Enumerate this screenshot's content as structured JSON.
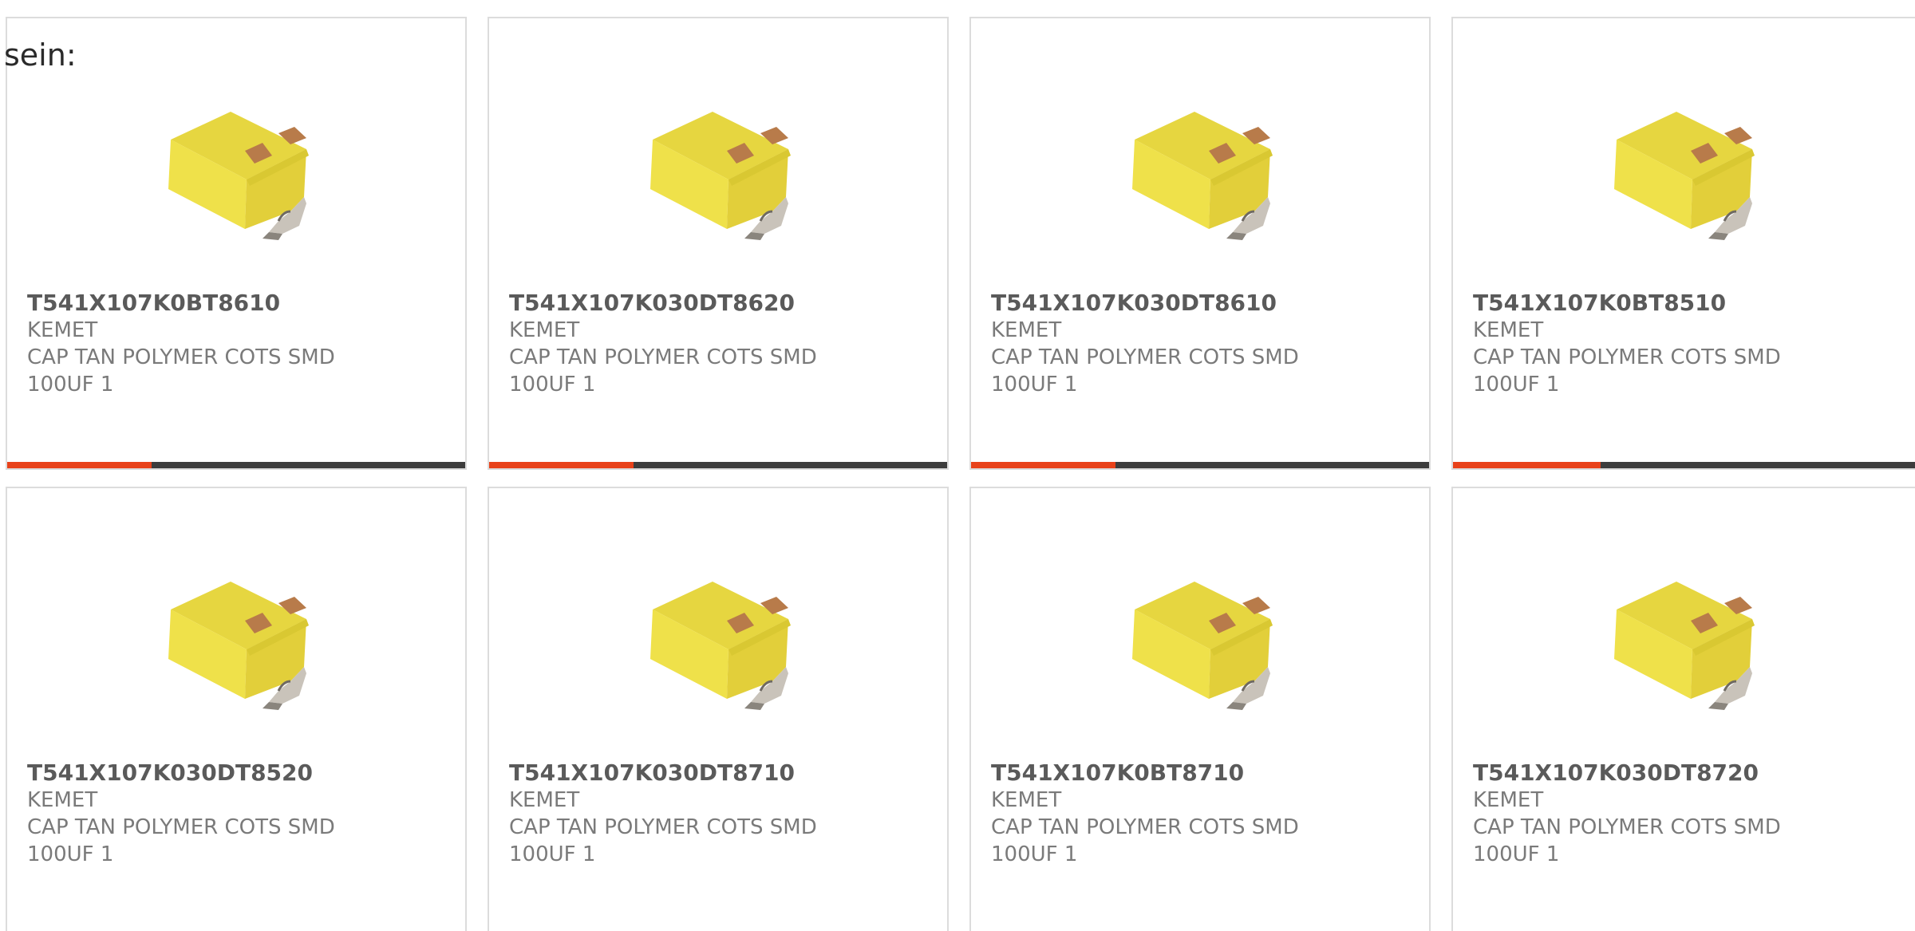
{
  "lead_text": "sein:",
  "colors": {
    "accent": "#e8421a",
    "bar": "#3d3d3d",
    "cap_body": "#efe14a",
    "terminal": "#b87b4a"
  },
  "progress_fraction": 0.315,
  "products": [
    {
      "part": "T541X107K0BT8610",
      "brand": "KEMET",
      "desc1": "CAP TAN POLYMER COTS SMD",
      "desc2": "100UF 1",
      "image": "tantalum-capacitor-icon"
    },
    {
      "part": "T541X107K030DT8620",
      "brand": "KEMET",
      "desc1": "CAP TAN POLYMER COTS SMD",
      "desc2": "100UF 1",
      "image": "tantalum-capacitor-icon"
    },
    {
      "part": "T541X107K030DT8610",
      "brand": "KEMET",
      "desc1": "CAP TAN POLYMER COTS SMD",
      "desc2": "100UF 1",
      "image": "tantalum-capacitor-icon"
    },
    {
      "part": "T541X107K0BT8510",
      "brand": "KEMET",
      "desc1": "CAP TAN POLYMER COTS SMD",
      "desc2": "100UF 1",
      "image": "tantalum-capacitor-icon"
    },
    {
      "part": "T541X107K030DT8520",
      "brand": "KEMET",
      "desc1": "CAP TAN POLYMER COTS SMD",
      "desc2": "100UF 1",
      "image": "tantalum-capacitor-icon"
    },
    {
      "part": "T541X107K030DT8710",
      "brand": "KEMET",
      "desc1": "CAP TAN POLYMER COTS SMD",
      "desc2": "100UF 1",
      "image": "tantalum-capacitor-icon"
    },
    {
      "part": "T541X107K0BT8710",
      "brand": "KEMET",
      "desc1": "CAP TAN POLYMER COTS SMD",
      "desc2": "100UF 1",
      "image": "tantalum-capacitor-icon"
    },
    {
      "part": "T541X107K030DT8720",
      "brand": "KEMET",
      "desc1": "CAP TAN POLYMER COTS SMD",
      "desc2": "100UF 1",
      "image": "tantalum-capacitor-icon"
    }
  ]
}
